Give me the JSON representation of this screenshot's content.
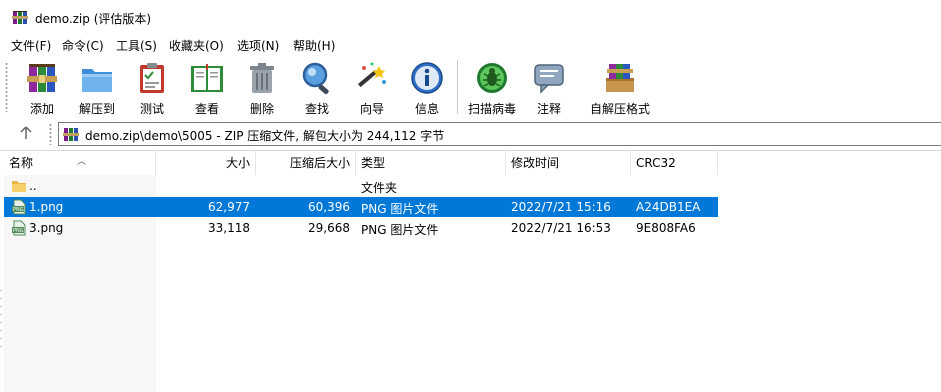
{
  "window": {
    "title": "demo.zip (评估版本)",
    "icon": "winrar-books-icon"
  },
  "menu": [
    "文件(F)",
    "命令(C)",
    "工具(S)",
    "收藏夹(O)",
    "选项(N)",
    "帮助(H)"
  ],
  "toolbar": {
    "buttons": [
      {
        "label": "添加",
        "icon": "add-archive-icon"
      },
      {
        "label": "解压到",
        "icon": "extract-to-folder-icon"
      },
      {
        "label": "测试",
        "icon": "test-clipboard-icon"
      },
      {
        "label": "查看",
        "icon": "view-book-icon"
      },
      {
        "label": "删除",
        "icon": "trash-icon"
      },
      {
        "label": "查找",
        "icon": "find-magnifier-icon"
      },
      {
        "label": "向导",
        "icon": "wizard-wand-icon"
      },
      {
        "label": "信息",
        "icon": "info-icon"
      },
      {
        "label": "扫描病毒",
        "icon": "virus-scan-icon"
      },
      {
        "label": "注释",
        "icon": "comment-icon"
      },
      {
        "label": "自解压格式",
        "icon": "sfx-archive-icon"
      }
    ]
  },
  "address": {
    "path": "demo.zip\\demo\\5005 - ZIP 压缩文件, 解包大小为 244,112 字节"
  },
  "columns": [
    "名称",
    "大小",
    "压缩后大小",
    "类型",
    "修改时间",
    "CRC32"
  ],
  "files": [
    {
      "name": "..",
      "size": "",
      "packed": "",
      "type": "文件夹",
      "modified": "",
      "crc": "",
      "icon": "folder-icon",
      "selected": false
    },
    {
      "name": "1.png",
      "size": "62,977",
      "packed": "60,396",
      "type": "PNG 图片文件",
      "modified": "2022/7/21 15:16",
      "crc": "A24DB1EA",
      "icon": "png-file-icon",
      "selected": true
    },
    {
      "name": "3.png",
      "size": "33,118",
      "packed": "29,668",
      "type": "PNG 图片文件",
      "modified": "2022/7/21 16:53",
      "crc": "9E808FA6",
      "icon": "png-file-icon",
      "selected": false
    }
  ],
  "colors": {
    "selection": "#0078d7"
  }
}
